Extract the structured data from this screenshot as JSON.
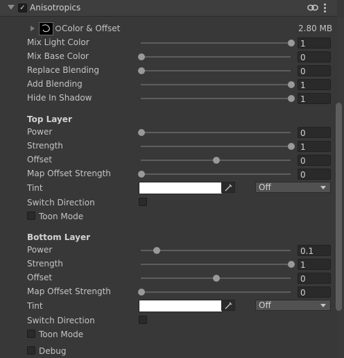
{
  "header": {
    "title": "Anisotropics",
    "enabled": true
  },
  "texture": {
    "label": "Color & Offset",
    "size": "2.80 MB"
  },
  "blend_props": [
    {
      "label": "Mix Light Color",
      "value": "1",
      "level": 1
    },
    {
      "label": "Mix Base Color",
      "value": "0",
      "level": 0
    },
    {
      "label": "Replace Blending",
      "value": "0",
      "level": 0
    },
    {
      "label": "Add Blending",
      "value": "1",
      "level": 1
    },
    {
      "label": "Hide In Shadow",
      "value": "1",
      "level": 1
    }
  ],
  "top_layer": {
    "heading": "Top Layer",
    "props": [
      {
        "label": "Power",
        "value": "0",
        "level": 0
      },
      {
        "label": "Strength",
        "value": "1",
        "level": 1
      },
      {
        "label": "Offset",
        "value": "0",
        "level": 0.5
      },
      {
        "label": "Map Offset Strength",
        "value": "0",
        "level": 0
      }
    ],
    "tint_label": "Tint",
    "tint_color": "#ffffff",
    "tint_mode": "Off",
    "switch_direction_label": "Switch Direction",
    "toon_mode_label": "Toon Mode"
  },
  "bottom_layer": {
    "heading": "Bottom Layer",
    "props": [
      {
        "label": "Power",
        "value": "0.1",
        "level": 0.1
      },
      {
        "label": "Strength",
        "value": "1",
        "level": 1
      },
      {
        "label": "Offset",
        "value": "0",
        "level": 0.5
      },
      {
        "label": "Map Offset Strength",
        "value": "0",
        "level": 0
      }
    ],
    "tint_label": "Tint",
    "tint_color": "#ffffff",
    "tint_mode": "Off",
    "switch_direction_label": "Switch Direction",
    "toon_mode_label": "Toon Mode"
  },
  "debug_label": "Debug"
}
